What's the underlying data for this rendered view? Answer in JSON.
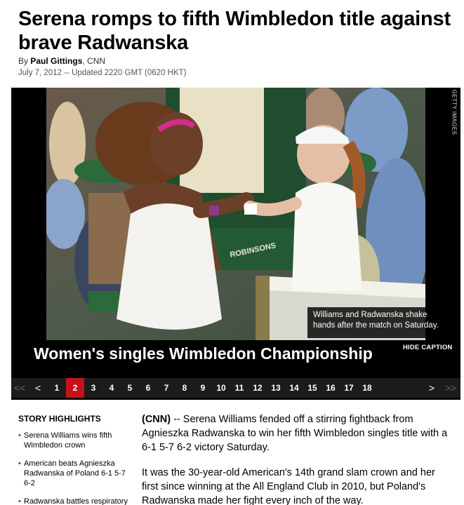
{
  "article": {
    "headline": "Serena romps to fifth Wimbledon title against brave Radwanska",
    "byline_prefix": "By",
    "author": "Paul Gittings",
    "byline_source": ", CNN",
    "dateline": "July 7, 2012 -- Updated 2220 GMT (0620 HKT)"
  },
  "gallery": {
    "photo_credit": "GETTY IMAGES",
    "caption": "Williams and Radwanska shake hands after the match on Saturday.",
    "title": "Women's singles Wimbledon Championship",
    "hide_caption_label": "HIDE CAPTION",
    "nav": {
      "first": "<<",
      "prev": "<",
      "next": ">",
      "last": ">>"
    },
    "pages": [
      "1",
      "2",
      "3",
      "4",
      "5",
      "6",
      "7",
      "8",
      "9",
      "10",
      "11",
      "12",
      "13",
      "14",
      "15",
      "16",
      "17",
      "18"
    ],
    "active_page": "2",
    "umpire_chair_text": "ROBINSONS"
  },
  "highlights": {
    "heading": "STORY HIGHLIGHTS",
    "items": [
      "Serena Williams wins fifth Wimbledon crown",
      "American beats Agnieszka Radwanska of Poland 6-1 5-7 6-2",
      "Radwanska battles respiratory"
    ]
  },
  "story": {
    "source": "(CNN)",
    "p1_rest": " -- Serena Williams fended off a stirring fightback from Agnieszka Radwanska to win her fifth Wimbledon singles title with a 6-1 5-7 6-2 victory Saturday.",
    "p2": "It was the 30-year-old American's 14th grand slam crown and her first since winning at the All England Club in 2010, but Poland's Radwanska made her fight every inch of the way."
  },
  "colors": {
    "accent_red": "#c4121b",
    "gallery_bg": "#000000",
    "pager_bg": "#1c1c1c"
  }
}
